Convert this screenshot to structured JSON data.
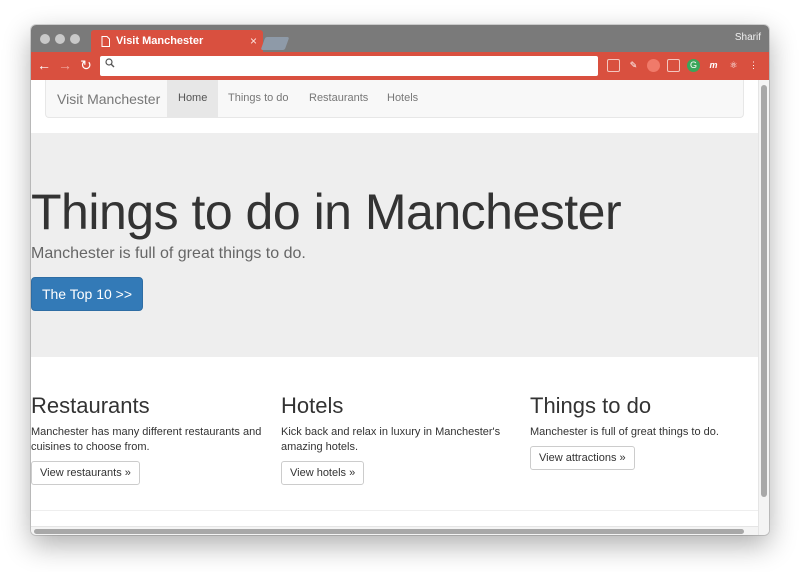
{
  "browser": {
    "tab_title": "Visit Manchester",
    "tab_close": "×",
    "user": "Sharif",
    "omnibox_value": ""
  },
  "site": {
    "brand": "Visit Manchester",
    "nav": [
      "Home",
      "Things to do",
      "Restaurants",
      "Hotels"
    ],
    "jumbotron": {
      "title": "Things to do in Manchester",
      "subtitle": "Manchester is full of great things to do.",
      "button": "The Top 10 >>"
    },
    "columns": [
      {
        "heading": "Restaurants",
        "text": "Manchester has many different restaurants and cuisines to choose from.",
        "button": "View restaurants »"
      },
      {
        "heading": "Hotels",
        "text": "Kick back and relax in luxury in Manchester's amazing hotels.",
        "button": "View hotels »"
      },
      {
        "heading": "Things to do",
        "text": "Manchester is full of great things to do.",
        "button": "View attractions »"
      }
    ]
  },
  "colors": {
    "chrome_accent": "#d9503f",
    "primary_button": "#337ab7",
    "jumbotron_bg": "#eeeeee"
  }
}
